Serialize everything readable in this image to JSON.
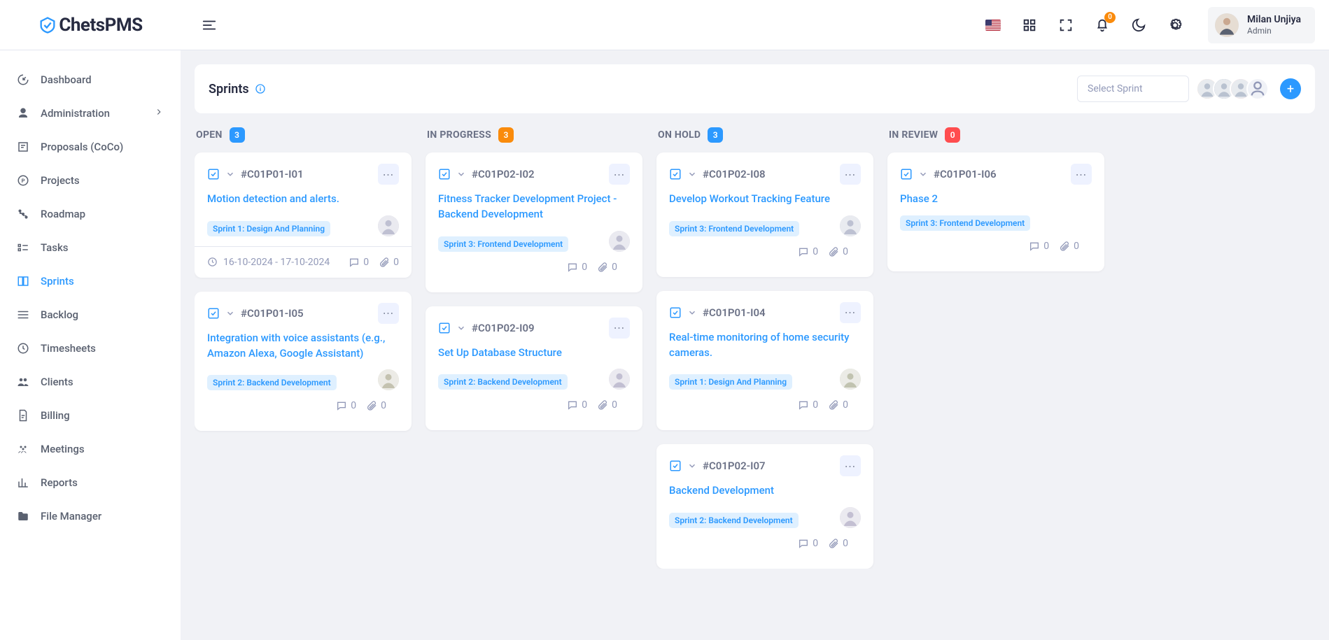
{
  "app": {
    "name": "ChetsPMS"
  },
  "user": {
    "name": "Milan Unjiya",
    "role": "Admin"
  },
  "header": {
    "notif_count": "0"
  },
  "sidebar": {
    "items": [
      {
        "label": "Dashboard",
        "icon": "gauge"
      },
      {
        "label": "Administration",
        "icon": "user-solid",
        "chevron": true
      },
      {
        "label": "Proposals (CoCo)",
        "icon": "proposal"
      },
      {
        "label": "Projects",
        "icon": "projects"
      },
      {
        "label": "Roadmap",
        "icon": "roadmap"
      },
      {
        "label": "Tasks",
        "icon": "tasks"
      },
      {
        "label": "Sprints",
        "icon": "sprints",
        "active": true
      },
      {
        "label": "Backlog",
        "icon": "backlog"
      },
      {
        "label": "Timesheets",
        "icon": "clock"
      },
      {
        "label": "Clients",
        "icon": "clients"
      },
      {
        "label": "Billing",
        "icon": "billing"
      },
      {
        "label": "Meetings",
        "icon": "meetings"
      },
      {
        "label": "Reports",
        "icon": "reports"
      },
      {
        "label": "File Manager",
        "icon": "folder"
      }
    ]
  },
  "page": {
    "title": "Sprints",
    "select_placeholder": "Select Sprint",
    "avatars": 4
  },
  "columns": [
    {
      "key": "open",
      "title": "OPEN",
      "count": "3",
      "badge": "bg-blue",
      "cards": [
        {
          "id": "#C01P01-I01",
          "title": "Motion detection and alerts.",
          "tag": "Sprint 1: Design And Planning",
          "avatarHue": 20,
          "hasDate": true,
          "date": "16-10-2024 - 17-10-2024",
          "comments": "0",
          "attachments": "0"
        },
        {
          "id": "#C01P01-I05",
          "title": "Integration with voice assistants (e.g., Amazon Alexa, Google Assistant)",
          "tag": "Sprint 2: Backend Development",
          "avatarHue": 200,
          "hasDate": false,
          "comments": "0",
          "attachments": "0"
        }
      ]
    },
    {
      "key": "inprogress",
      "title": "IN PROGRESS",
      "count": "3",
      "badge": "bg-orange",
      "cards": [
        {
          "id": "#C01P02-I02",
          "title": "Fitness Tracker Development Project - Backend Development",
          "tag": "Sprint 3: Frontend Development",
          "avatarHue": 25,
          "hasDate": false,
          "comments": "0",
          "attachments": "0"
        },
        {
          "id": "#C01P02-I09",
          "title": "Set Up Database Structure",
          "tag": "Sprint 2: Backend Development",
          "avatarHue": 30,
          "hasDate": false,
          "comments": "0",
          "attachments": "0"
        }
      ]
    },
    {
      "key": "onhold",
      "title": "ON HOLD",
      "count": "3",
      "badge": "bg-blue",
      "cards": [
        {
          "id": "#C01P02-I08",
          "title": "Develop Workout Tracking Feature",
          "tag": "Sprint 3: Frontend Development",
          "avatarHue": 15,
          "hasDate": false,
          "comments": "0",
          "attachments": "0"
        },
        {
          "id": "#C01P01-I04",
          "title": "Real-time monitoring of home security cameras.",
          "tag": "Sprint 1: Design And Planning",
          "avatarHue": 210,
          "hasDate": false,
          "comments": "0",
          "attachments": "0"
        },
        {
          "id": "#C01P02-I07",
          "title": "Backend Development",
          "tag": "Sprint 2: Backend Development",
          "avatarHue": 35,
          "hasDate": false,
          "comments": "0",
          "attachments": "0"
        }
      ]
    },
    {
      "key": "inreview",
      "title": "IN REVIEW",
      "count": "0",
      "badge": "bg-red",
      "cards": [
        {
          "id": "#C01P01-I06",
          "title": "Phase 2",
          "tag": "Sprint 3: Frontend Development",
          "avatarHue": 0,
          "hasDate": false,
          "comments": "0",
          "attachments": "0",
          "noAvatar": true
        }
      ]
    }
  ]
}
